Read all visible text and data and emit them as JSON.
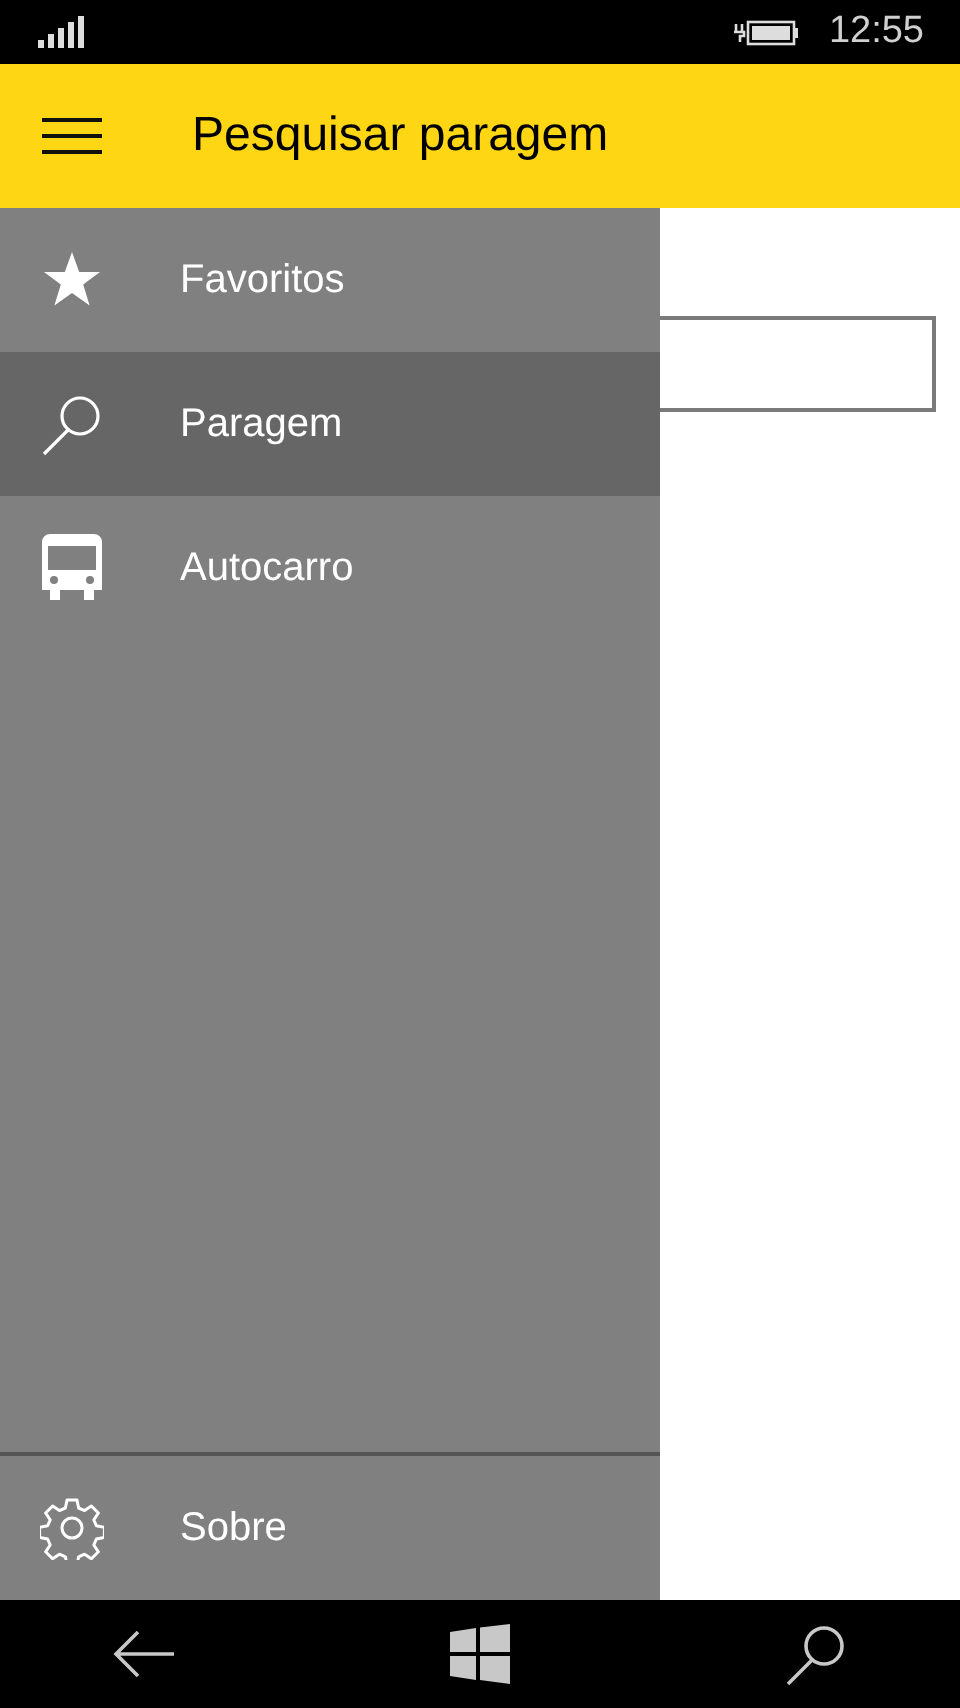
{
  "status_bar": {
    "time": "12:55"
  },
  "header": {
    "title": "Pesquisar paragem"
  },
  "menu": {
    "items": [
      {
        "kind": "star",
        "label": "Favoritos",
        "selected": false
      },
      {
        "kind": "search",
        "label": "Paragem",
        "selected": true
      },
      {
        "kind": "bus",
        "label": "Autocarro",
        "selected": false
      }
    ],
    "footer_items": [
      {
        "kind": "gear",
        "label": "Sobre",
        "selected": false
      }
    ]
  }
}
